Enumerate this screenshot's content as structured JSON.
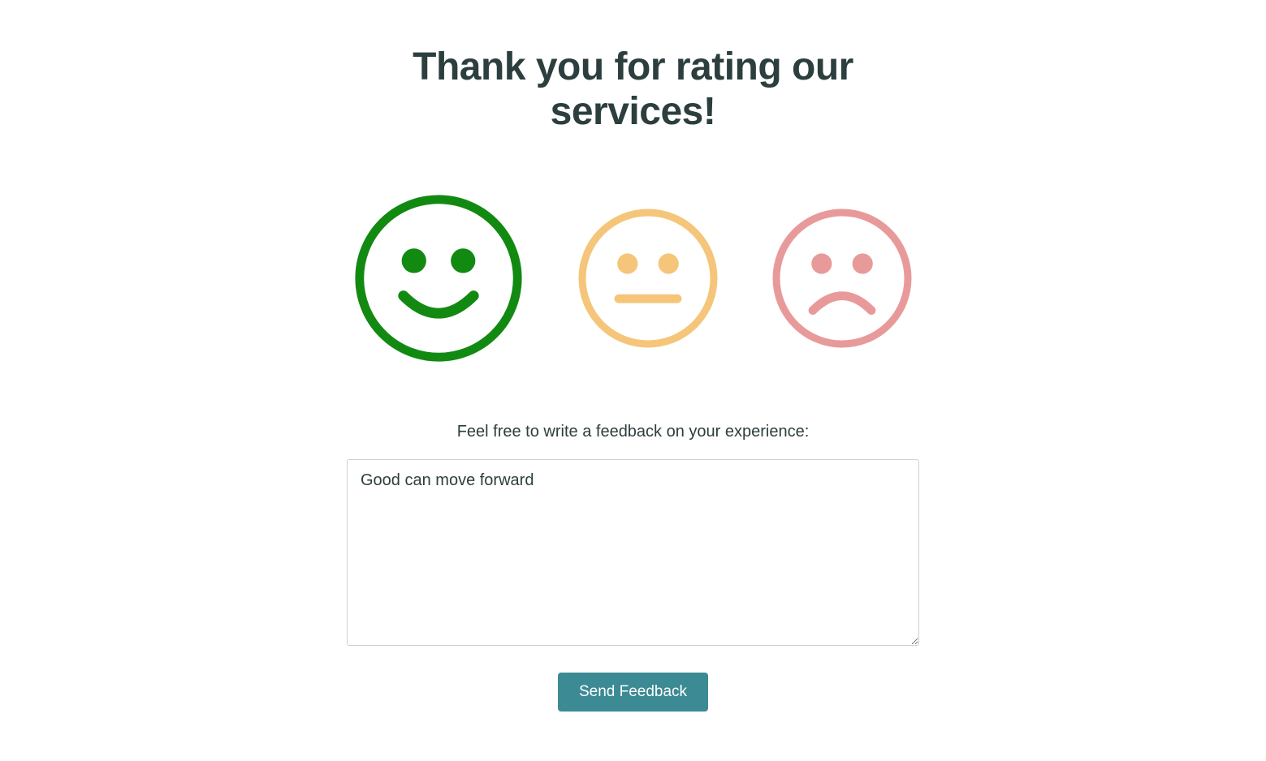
{
  "heading": "Thank you for rating our services!",
  "faces": {
    "happy": {
      "selected": true,
      "color": "#128a12"
    },
    "neutral": {
      "selected": false,
      "color": "#f5c57a"
    },
    "sad": {
      "selected": false,
      "color": "#e89a9a"
    }
  },
  "feedback": {
    "prompt": "Feel free to write a feedback on your experience:",
    "value": "Good can move forward",
    "placeholder": ""
  },
  "submit": {
    "label": "Send Feedback"
  }
}
